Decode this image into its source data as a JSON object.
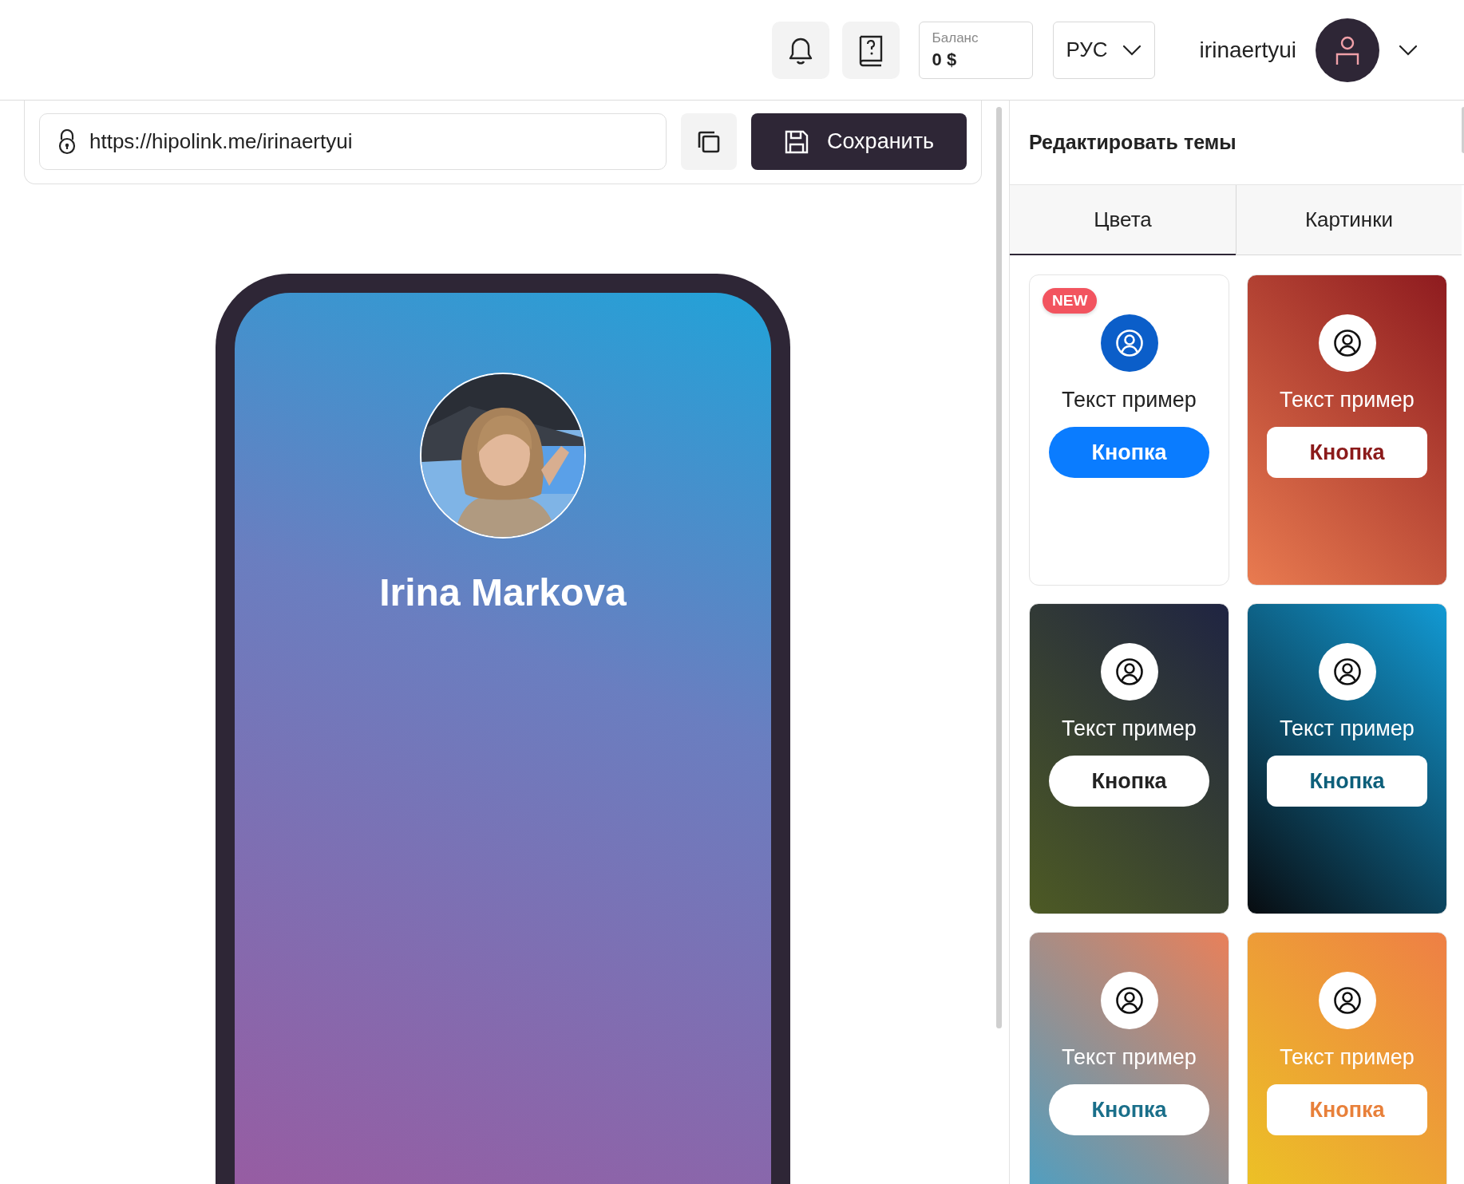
{
  "header": {
    "balance": {
      "label": "Баланс",
      "value": "0 $"
    },
    "language": "РУС",
    "username": "irinaertyui"
  },
  "editor": {
    "url": "https://hipolink.me/irinaertyui",
    "save_button": "Сохранить",
    "preview": {
      "name": "Irina Markova"
    }
  },
  "themes_panel": {
    "title": "Редактировать темы",
    "tabs": [
      {
        "label": "Цвета",
        "selected": true
      },
      {
        "label": "Картинки",
        "selected": false
      }
    ],
    "themes": [
      {
        "badge": "NEW",
        "text": "Текст пример",
        "button": "Кнопка",
        "kind": "light",
        "color": "#ffffff"
      },
      {
        "text": "Текст пример",
        "button": "Кнопка",
        "kind": "crimson",
        "color": "#8e1b1f"
      },
      {
        "text": "Текст пример",
        "button": "Кнопка",
        "kind": "forest",
        "color": "#1f2442"
      },
      {
        "text": "Текст пример",
        "button": "Кнопка",
        "kind": "ocean",
        "color": "#129ad4"
      },
      {
        "text": "Текст пример",
        "button": "Кнопка",
        "kind": "dusk",
        "color": "#e8805a"
      },
      {
        "text": "Текст пример",
        "button": "Кнопка",
        "kind": "citrus",
        "color": "#ee7f45"
      }
    ]
  }
}
